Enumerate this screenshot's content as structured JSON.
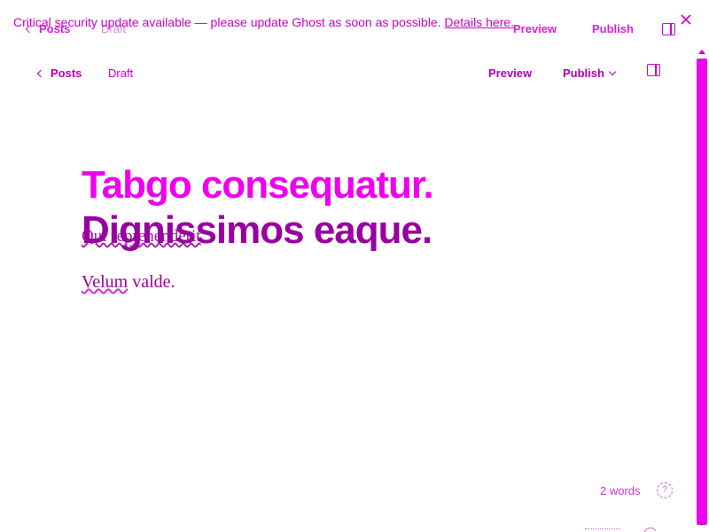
{
  "banner": {
    "message": "Critical security update available — please update Ghost as soon as possible.",
    "link_text": "Details here."
  },
  "ghost_bar": {
    "back_label": "Posts",
    "status": "Draft",
    "preview_label": "Preview",
    "publish_label": "Publish"
  },
  "topbar": {
    "back_label": "Posts",
    "status": "Draft",
    "preview_label": "Preview",
    "publish_label": "Publish"
  },
  "editor": {
    "title_line1": "Tabgo consequatur.",
    "title_line2": "Dignissimos eaque.",
    "excerpt": "Qui reprehenderit",
    "body_word1": "Velum",
    "body_rest": " valde."
  },
  "footer": {
    "word_count": "2 words",
    "help_icon_glyph": "?"
  },
  "colors": {
    "accent": "#ee00ee",
    "dark": "#990099"
  }
}
